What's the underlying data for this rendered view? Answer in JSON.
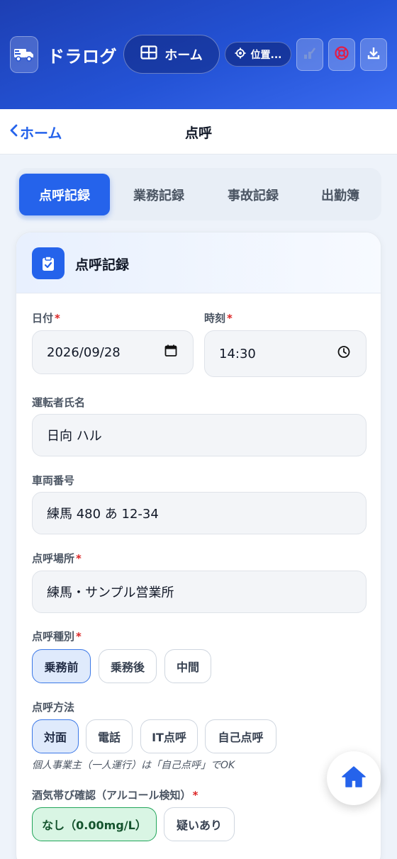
{
  "header": {
    "app_title": "ドラログ",
    "home_button": "ホーム",
    "location_button": "位置...",
    "icons": [
      "truck-icon",
      "grid-icon",
      "location-icon",
      "chart-icon",
      "lifebuoy-icon",
      "download-icon"
    ]
  },
  "navbar": {
    "back_label": "ホーム",
    "title": "点呼"
  },
  "tabs": [
    {
      "label": "点呼記録",
      "active": true
    },
    {
      "label": "業務記録",
      "active": false
    },
    {
      "label": "事故記録",
      "active": false
    },
    {
      "label": "出勤簿",
      "active": false
    }
  ],
  "card": {
    "title": "点呼記録",
    "fields": {
      "date": {
        "label": "日付",
        "required": "*",
        "value": "2026/09/28"
      },
      "time": {
        "label": "時刻",
        "required": "*",
        "value": "14:30"
      },
      "driver": {
        "label": "運転者氏名",
        "value": "日向 ハル"
      },
      "vehicle": {
        "label": "車両番号",
        "value": "練馬 480 あ 12-34"
      },
      "place": {
        "label": "点呼場所",
        "required": "*",
        "value": "練馬・サンプル営業所"
      }
    },
    "roll_type": {
      "label": "点呼種別",
      "required": "*",
      "options": [
        "乗務前",
        "乗務後",
        "中間"
      ],
      "selected": "乗務前"
    },
    "method": {
      "label": "点呼方法",
      "options": [
        "対面",
        "電話",
        "IT点呼",
        "自己点呼"
      ],
      "selected": "対面",
      "note": "個人事業主（一人運行）は「自己点呼」でOK"
    },
    "alcohol": {
      "label": "酒気帯び確認（アルコール検知）",
      "required": "*",
      "options": [
        "なし（0.00mg/L）",
        "疑いあり"
      ],
      "selected": "なし（0.00mg/L）"
    }
  },
  "colors": {
    "primary": "#2563eb",
    "header_start": "#1d3fb3",
    "success": "#22a55a",
    "danger": "#dc2626"
  }
}
